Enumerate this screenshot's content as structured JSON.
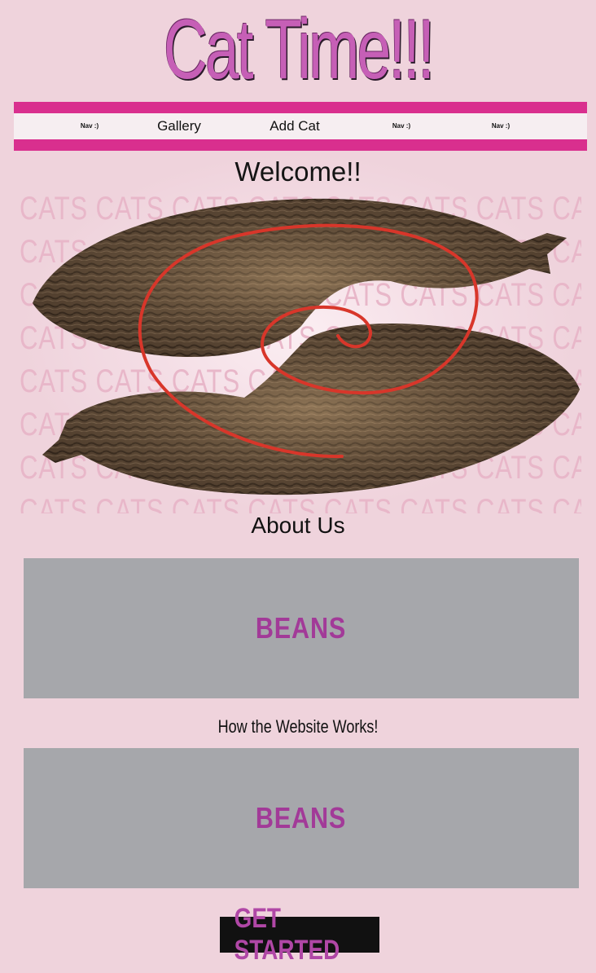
{
  "header": {
    "title": "Cat Time!!!"
  },
  "nav": {
    "items": [
      {
        "label": "Nav :)"
      },
      {
        "label": "Gallery"
      },
      {
        "label": "Add Cat"
      },
      {
        "label": "Nav :)"
      },
      {
        "label": "Nav :)"
      }
    ]
  },
  "hero": {
    "welcome": "Welcome!!",
    "pattern_word": "CATS"
  },
  "about": {
    "heading": "About Us",
    "panel_text": "BEANS"
  },
  "how": {
    "heading": "How the Website Works!",
    "panel_text": "BEANS"
  },
  "cta": {
    "label": "GET STARTED"
  },
  "colors": {
    "background": "#efd3dc",
    "accent_bar": "#d92f8e",
    "title": "#c65fb6",
    "panel": "#a6a7ab",
    "panel_text": "#a23a98",
    "button_bg": "#111111",
    "button_text": "#b047a6",
    "spiral": "#d8362a"
  }
}
